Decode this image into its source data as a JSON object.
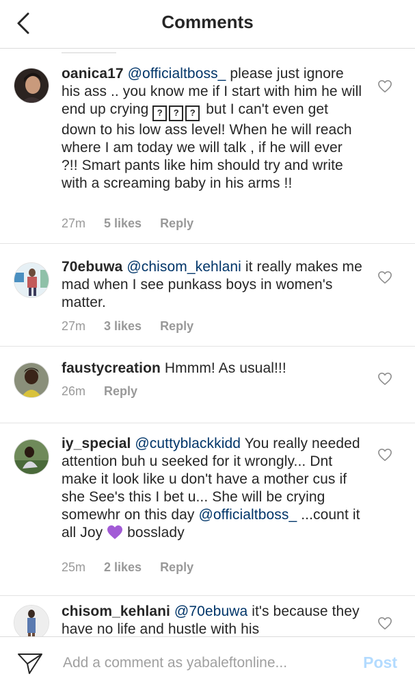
{
  "header": {
    "title": "Comments",
    "back_icon": "chevron-left-icon"
  },
  "comments": [
    {
      "username": "oanica17",
      "mention": "@officialtboss_",
      "text_1": " please just ignore his ass .. you know me if I start with him he will end up crying ",
      "text_2": " but I can't even get down to his low ass level! When he will reach where I am today we will talk , if he will ever ?!! Smart pants like him should try and write with a screaming baby in his arms !!",
      "unknown_glyph": "?",
      "time": "27m",
      "likes": "5 likes",
      "reply": "Reply"
    },
    {
      "username": "70ebuwa",
      "mention": "@chisom_kehlani",
      "text": " it really makes me mad when I see punkass boys in women's matter.",
      "time": "27m",
      "likes": "3 likes",
      "reply": "Reply"
    },
    {
      "username": "faustycreation",
      "text": " Hmmm! As usual!!!",
      "time": "26m",
      "reply": "Reply"
    },
    {
      "username": "iy_special",
      "mention": "@cuttyblackkidd",
      "text_1": " You really needed attention buh u seeked for it wrongly... Dnt make it look like u don't have a mother cus if she See's this I bet u... She will be crying somewhr on this day ",
      "mention_2": "@officialtboss_",
      "text_2": " ...count it all Joy ",
      "text_3": " bosslady",
      "time": "25m",
      "likes": "2 likes",
      "reply": "Reply"
    },
    {
      "username": "chisom_kehlani",
      "mention": "@70ebuwa",
      "text": " it's because they have no life and hustle with his"
    }
  ],
  "footer": {
    "placeholder": "Add a comment as yabaleftonline...",
    "post_label": "Post",
    "send_icon": "direct-send-icon"
  },
  "colors": {
    "text": "#262626",
    "mention": "#003569",
    "meta": "#999999",
    "post_disabled": "#b3dbff",
    "divider": "#dbdbdb"
  }
}
